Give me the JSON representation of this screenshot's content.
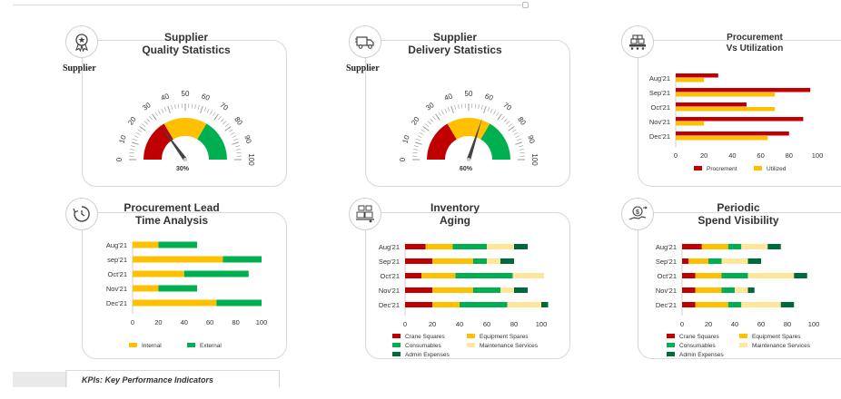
{
  "colors": {
    "red": "#c00000",
    "yellow": "#ffc000",
    "green": "#00b050",
    "lightyellow": "#ffe699",
    "darkgreen": "#006b3a",
    "dark": "#333333"
  },
  "footer": {
    "text": "KPIs: Key Performance  Indicators"
  },
  "cards": {
    "quality": {
      "title1": "Supplier",
      "title2": "Quality Statistics",
      "side_label": "Supplier",
      "icon": "award-badge-icon"
    },
    "delivery": {
      "title1": "Supplier",
      "title2": "Delivery Statistics",
      "side_label": "Supplier",
      "icon": "delivery-truck-icon"
    },
    "procurement": {
      "title1": "Procurement",
      "title2": "Vs Utilization",
      "icon": "conveyor-boxes-icon"
    },
    "leadtime": {
      "title1": "Procurement Lead",
      "title2": "Time Analysis",
      "icon": "clock-history-icon"
    },
    "inventory": {
      "title1": "Inventory",
      "title2": "Aging",
      "icon": "warehouse-boxes-icon"
    },
    "spend": {
      "title1": "Periodic",
      "title2": "Spend Visibility",
      "icon": "money-hand-icon"
    }
  },
  "chart_data": [
    {
      "id": "quality_gauge",
      "type": "gauge",
      "ticks": [
        0,
        10,
        20,
        30,
        40,
        50,
        60,
        70,
        80,
        90,
        100
      ],
      "bands": [
        {
          "from": 0,
          "to": 33,
          "color": "#c00000"
        },
        {
          "from": 33,
          "to": 67,
          "color": "#ffc000"
        },
        {
          "from": 67,
          "to": 100,
          "color": "#00b050"
        }
      ],
      "value": 30,
      "value_label": "30%"
    },
    {
      "id": "delivery_gauge",
      "type": "gauge",
      "ticks": [
        0,
        10,
        20,
        30,
        40,
        50,
        60,
        70,
        80,
        90,
        100
      ],
      "bands": [
        {
          "from": 0,
          "to": 33,
          "color": "#c00000"
        },
        {
          "from": 33,
          "to": 67,
          "color": "#ffc000"
        },
        {
          "from": 67,
          "to": 100,
          "color": "#00b050"
        }
      ],
      "value": 60,
      "value_label": "60%"
    },
    {
      "id": "procurement",
      "type": "bar",
      "orientation": "horizontal",
      "categories": [
        "Aug'21",
        "Sep'21",
        "Oct'21",
        "Nov'21",
        "Dec'21"
      ],
      "series": [
        {
          "name": "Procrement",
          "color": "#c00000",
          "values": [
            30,
            95,
            50,
            90,
            80
          ]
        },
        {
          "name": "Utilized",
          "color": "#ffc000",
          "values": [
            20,
            70,
            70,
            20,
            65
          ]
        }
      ],
      "xticks": [
        0,
        20,
        40,
        60,
        80,
        100
      ],
      "xlim": [
        0,
        100
      ],
      "legend": "bottom"
    },
    {
      "id": "leadtime",
      "type": "bar",
      "orientation": "horizontal",
      "stacked": true,
      "categories": [
        "Aug'21",
        "sep'21",
        "Oct'21",
        "Nov'21",
        "Dec'21"
      ],
      "series": [
        {
          "name": "Internal",
          "color": "#ffc000",
          "values": [
            20,
            70,
            40,
            20,
            65
          ]
        },
        {
          "name": "External",
          "color": "#00b050",
          "values": [
            30,
            30,
            50,
            30,
            35
          ]
        }
      ],
      "xticks": [
        0,
        20,
        40,
        60,
        80,
        100
      ],
      "xlim": [
        0,
        100
      ],
      "legend": "bottom"
    },
    {
      "id": "inventory",
      "type": "bar",
      "orientation": "horizontal",
      "stacked": true,
      "categories": [
        "Aug'21",
        "Sep'21",
        "Oct'21",
        "Nov'21",
        "Dec'21"
      ],
      "series": [
        {
          "name": "Crane Squares",
          "color": "#c00000",
          "values": [
            15,
            20,
            12,
            20,
            20
          ]
        },
        {
          "name": "Equipment Spares",
          "color": "#ffc000",
          "values": [
            20,
            30,
            25,
            30,
            20
          ]
        },
        {
          "name": "Consumables",
          "color": "#00b050",
          "values": [
            25,
            10,
            42,
            20,
            35
          ]
        },
        {
          "name": "Maintenance Services",
          "color": "#ffe699",
          "values": [
            20,
            10,
            23,
            10,
            25
          ]
        },
        {
          "name": "Admin Expenses",
          "color": "#006b3a",
          "values": [
            10,
            10,
            0,
            10,
            5
          ]
        }
      ],
      "xticks": [
        0,
        20,
        40,
        60,
        80,
        100
      ],
      "xlim": [
        0,
        100
      ],
      "legend": "bottom"
    },
    {
      "id": "spend",
      "type": "bar",
      "orientation": "horizontal",
      "stacked": true,
      "categories": [
        "Aug'21",
        "Sep'21",
        "Oct'21",
        "Nov'21",
        "Dec'21"
      ],
      "series": [
        {
          "name": "Crane Squares",
          "color": "#c00000",
          "values": [
            15,
            5,
            10,
            10,
            10
          ]
        },
        {
          "name": "Equipment Spares",
          "color": "#ffc000",
          "values": [
            20,
            15,
            20,
            20,
            25
          ]
        },
        {
          "name": "Consumables",
          "color": "#00b050",
          "values": [
            10,
            10,
            20,
            10,
            10
          ]
        },
        {
          "name": "Maintenance Services",
          "color": "#ffe699",
          "values": [
            20,
            20,
            35,
            10,
            30
          ]
        },
        {
          "name": "Admin Expenses",
          "color": "#006b3a",
          "values": [
            10,
            10,
            10,
            5,
            10
          ]
        }
      ],
      "xticks": [
        0,
        20,
        40,
        60,
        80,
        100
      ],
      "xlim": [
        0,
        100
      ],
      "legend": "bottom"
    }
  ]
}
